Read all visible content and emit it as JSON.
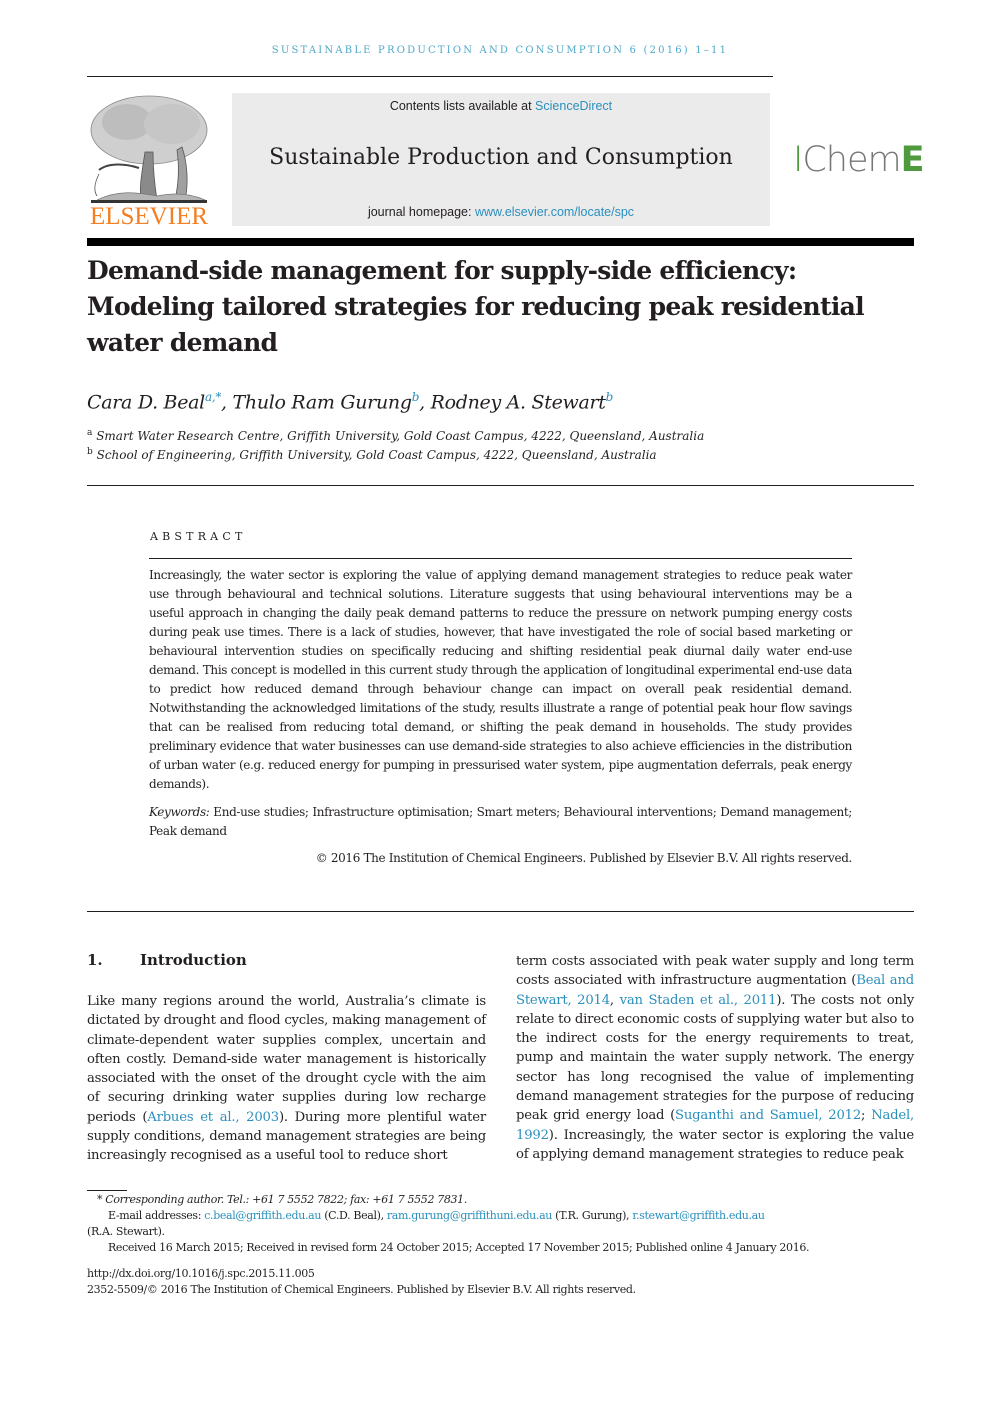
{
  "running_head": "SUSTAINABLE PRODUCTION AND CONSUMPTION 6 (2016) 1–11",
  "header": {
    "contents_prefix": "Contents lists available at ",
    "contents_link": "ScienceDirect",
    "journal_name": "Sustainable Production and Consumption",
    "homepage_prefix": "journal homepage: ",
    "homepage_link": "www.elsevier.com/locate/spc",
    "publisher_logo_text": "ELSEVIER",
    "society_logo": {
      "part1": "I",
      "part2": "Chem",
      "part3": "E"
    }
  },
  "colors": {
    "link": "#2a8fbd",
    "elsevier_orange": "#f47e20",
    "icheme_green": "#4e9a3d",
    "header_box": "#ebebeb",
    "running_head": "#4fa8c9"
  },
  "article": {
    "title": "Demand-side management for supply-side efficiency: Modeling tailored strategies for reducing peak residential water demand",
    "authors": [
      {
        "name": "Cara D. Beal",
        "marks": "a,*"
      },
      {
        "name": "Thulo Ram Gurung",
        "marks": "b"
      },
      {
        "name": "Rodney A. Stewart",
        "marks": "b"
      }
    ],
    "affiliations": [
      {
        "mark": "a",
        "text": "Smart Water Research Centre, Griffith University, Gold Coast Campus, 4222, Queensland, Australia"
      },
      {
        "mark": "b",
        "text": "School of Engineering, Griffith University, Gold Coast Campus, 4222, Queensland, Australia"
      }
    ]
  },
  "abstract": {
    "label": "ABSTRACT",
    "text": "Increasingly, the water sector is exploring the value of applying demand management strategies to reduce peak water use through behavioural and technical solutions. Literature suggests that using behavioural interventions may be a useful approach in changing the daily peak demand patterns to reduce the pressure on network pumping energy costs during peak use times. There is a lack of studies, however, that have investigated the role of social based marketing or behavioural intervention studies on specifically reducing and shifting residential peak diurnal daily water end-use demand. This concept is modelled in this current study through the application of longitudinal experimental end-use data to predict how reduced demand through behaviour change can impact on overall peak residential demand. Notwithstanding the acknowledged limitations of the study, results illustrate a range of potential peak hour flow savings that can be realised from reducing total demand, or shifting the peak demand in households. The study provides preliminary evidence that water businesses can use demand-side strategies to also achieve efficiencies in the distribution of urban water (e.g. reduced energy for pumping in pressurised water system, pipe augmentation deferrals, peak energy demands).",
    "keywords_label": "Keywords:",
    "keywords": "End-use studies; Infrastructure optimisation; Smart meters; Behavioural interventions; Demand management; Peak demand",
    "copyright": "© 2016 The Institution of Chemical Engineers. Published by Elsevier B.V. All rights reserved."
  },
  "section1": {
    "number": "1.",
    "heading": "Introduction",
    "left": {
      "p1": "Like many regions around the world, Australia’s climate is dictated by drought and flood cycles, making management of climate-dependent water supplies complex, uncertain and often costly. Demand-side water management is historically associated with the onset of the drought cycle with the aim of securing drinking water supplies during low recharge periods (",
      "cite1": "Arbues et al., 2003",
      "p2": "). During more plentiful water supply conditions, demand management strategies are being increasingly recognised as a useful tool to reduce short"
    },
    "right": {
      "p1": "term costs associated with peak water supply and long term costs associated with infrastructure augmentation (",
      "cite1": "Beal and Stewart, 2014",
      "sep1": ", ",
      "cite2": "van Staden et al., 2011",
      "p2": "). The costs not only relate to direct economic costs of supplying water but also to the indirect costs for the energy requirements to treat, pump and maintain the water supply network. The energy sector has long recognised the value of implementing demand management strategies for the purpose of reducing peak grid energy load (",
      "cite3": "Suganthi and Samuel, 2012",
      "sep2": "; ",
      "cite4": "Nadel, 1992",
      "p3": "). Increasingly, the water sector is exploring the value of applying demand management strategies to reduce peak"
    }
  },
  "footnotes": {
    "corresponding": "* Corresponding author. Tel.: +61 7 5552 7822; fax: +61 7 5552 7831.",
    "email_prefix": "E-mail addresses: ",
    "emails": [
      {
        "address": "c.beal@griffith.edu.au",
        "who": " (C.D. Beal), "
      },
      {
        "address": "ram.gurung@griffithuni.edu.au",
        "who": " (T.R. Gurung), "
      },
      {
        "address": "r.stewart@griffith.edu.au",
        "who": " (R.A. Stewart)."
      }
    ],
    "dates": "Received 16 March 2015; Received in revised form 24 October 2015; Accepted 17 November 2015; Published online 4 January 2016.",
    "doi": "http://dx.doi.org/10.1016/j.spc.2015.11.005",
    "issn": "2352-5509/© 2016 The Institution of Chemical Engineers. Published by Elsevier B.V. All rights reserved."
  }
}
